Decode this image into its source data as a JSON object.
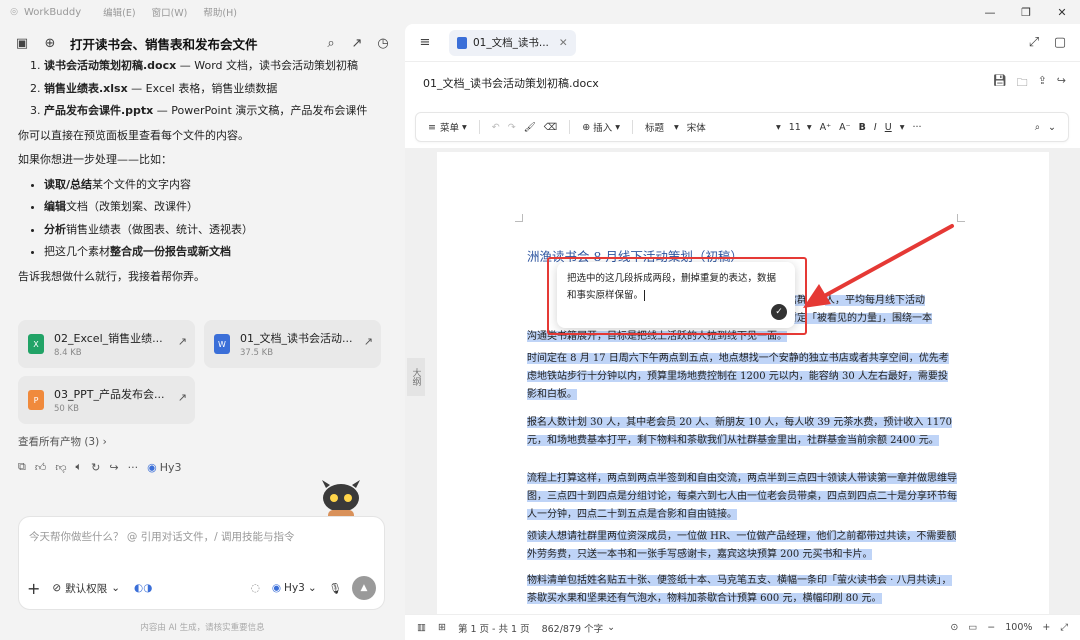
{
  "titlebar": {
    "app_name": "WorkBuddy",
    "menus": [
      "编辑(E)",
      "窗口(W)",
      "帮助(H)"
    ],
    "window_controls": [
      "—",
      "❐",
      "✕"
    ]
  },
  "left": {
    "title": "打开读书会、销售表和发布会文件",
    "list1": [
      {
        "bold": "读书会活动策划初稿.docx",
        "rest": " — Word 文档，读书会活动策划初稿"
      },
      {
        "bold": "销售业绩表.xlsx",
        "rest": " — Excel 表格，销售业绩数据"
      },
      {
        "bold": "产品发布会课件.pptx",
        "rest": " — PowerPoint 演示文稿，产品发布会课件"
      }
    ],
    "p1": "你可以直接在预览面板里查看每个文件的内容。",
    "p2": "如果你想进一步处理——比如：",
    "list2": [
      {
        "bold": "读取/总结",
        "rest": "某个文件的文字内容"
      },
      {
        "bold": "编辑",
        "rest": "文档（改策划案、改课件）"
      },
      {
        "bold": "分析",
        "rest": "销售业绩表（做图表、统计、透视表）"
      },
      {
        "pre": "把这几个素材",
        "bold": "整合成一份报告或新文档",
        "rest": ""
      }
    ],
    "p3": "告诉我想做什么就行，我接着帮你弄。",
    "files": [
      {
        "name": "02_Excel_销售业绩...",
        "size": "8.4 KB",
        "color": "#21a366",
        "glyph": "X"
      },
      {
        "name": "01_文档_读书会活动...",
        "size": "37.5 KB",
        "color": "#3b6fd8",
        "glyph": "W"
      },
      {
        "name": "03_PPT_产品发布会...",
        "size": "50 KB",
        "color": "#f08a3c",
        "glyph": "P"
      }
    ],
    "all_outputs": "查看所有产物 (3)",
    "model_tag": "Hy3",
    "input_placeholder": "今天帮你做些什么？ @ 引用对话文件，/ 调用技能与指令",
    "permission": "默认权限",
    "model_select": "Hy3",
    "disclaimer": "内容由 AI 生成，请核实重要信息"
  },
  "right": {
    "tab_label": "01_文档_读书...",
    "doc_name": "01_文档_读书会活动策划初稿.docx",
    "toolbar": {
      "menu": "菜单",
      "insert": "插入",
      "style": "标题",
      "font": "宋体",
      "size": "11"
    },
    "outline_label": "大纲",
    "doc_title": "洲渔读书会 8 月线下活动策划（初稿）",
    "popup_text": "把选中的这几段拆成两段，删掉重复的表达，数据和事实原样保留。",
    "para1_a": "前微信群",
    "para1_b": "人，平均每月线下活动",
    "para1_c": "主题暂定「被看见的力量」，围绕一本",
    "para1_d": "沟通类书籍展开，目标是把线上活跃的人拉到线下见一面。",
    "para2": "时间定在 8 月 17 日周六下午两点到五点，地点想找一个安静的独立书店或者共享空间，优先考虑地铁站步行十分钟以内，预算里场地费控制在 1200 元以内，能容纳 30 人左右最好，需要投影和白板。",
    "para3": "报名人数计划 30 人，其中老会员 20 人、新朋友 10 人，每人收 39 元茶水费，预计收入 1170 元，和场地费基本打平，剩下物料和茶歇我们从社群基金里出，社群基金当前余额 2400 元。",
    "para4": "流程上打算这样，两点到两点半签到和自由交流，两点半到三点四十领读人带读第一章并做思维导图，三点四十到四点是分组讨论，每桌六到七人由一位老会员带桌，四点到四点二十是分享环节每人一分钟，四点二十到五点是合影和自由链接。",
    "para5": "领读人想请社群里两位资深成员，一位做 HR、一位做产品经理，他们之前都带过共读，不需要额外劳务费，只送一本书和一张手写感谢卡，嘉宾这块预算 200 元买书和卡片。",
    "para6": "物料清单包括姓名贴五十张、便签纸十本、马克笔五支、横幅一条印「萤火读书会 · 八月共读」，茶歇买水果和坚果还有气泡水，物料加茶歇合计预算 600 元，横幅印刷 80 元。",
    "status": {
      "page": "第 1 页 - 共 1 页",
      "words": "862/879 个字",
      "zoom": "100%"
    }
  }
}
